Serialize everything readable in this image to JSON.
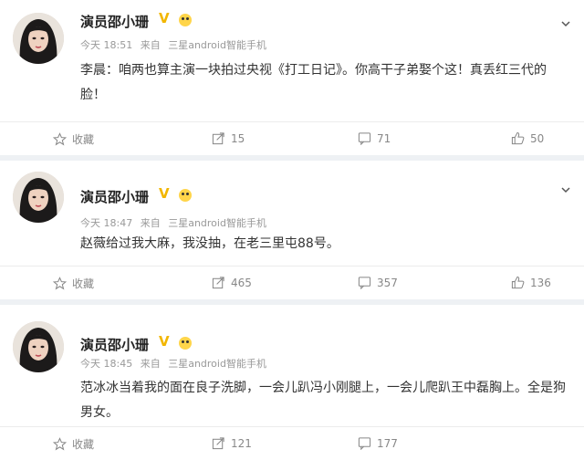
{
  "posts": [
    {
      "user": "演员邵小珊",
      "time": "今天 18:51",
      "source_prefix": "来自",
      "source": "三星android智能手机",
      "text": "李晨：咱两也算主演一块拍过央视《打工日记》。你高干子弟娶个这！真丢红三代的脸！",
      "favorite_label": "收藏",
      "repost_count": "15",
      "comment_count": "71",
      "like_count": "50"
    },
    {
      "user": "演员邵小珊",
      "time": "今天 18:47",
      "source_prefix": "来自",
      "source": "三星android智能手机",
      "text": "赵薇给过我大麻，我没抽，在老三里屯88号。",
      "favorite_label": "收藏",
      "repost_count": "465",
      "comment_count": "357",
      "like_count": "136"
    },
    {
      "user": "演员邵小珊",
      "time": "今天 18:45",
      "source_prefix": "来自",
      "source": "三星android智能手机",
      "text": "范冰冰当着我的面在良子洗脚，一会儿趴冯小刚腿上，一会儿爬趴王中磊胸上。全是狗男女。",
      "favorite_label": "收藏",
      "repost_count": "121",
      "comment_count": "177",
      "like_count": ""
    }
  ],
  "colors": {
    "vip_badge": "#f2b600",
    "background": "#eef1f4",
    "meta_text": "#999999"
  }
}
